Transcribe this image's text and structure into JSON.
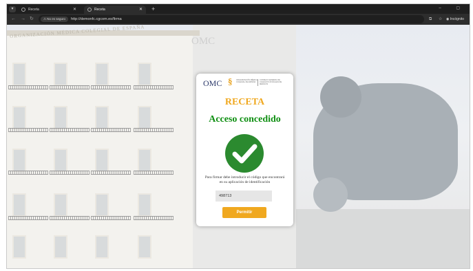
{
  "browser": {
    "tabs": [
      {
        "title": "Receta",
        "active": false
      },
      {
        "title": "Receta",
        "active": true
      }
    ],
    "new_tab": "+",
    "window_controls": "– ▢",
    "security_chip": "No es seguro",
    "url": "http://demonfc.cgcom.es/firma",
    "profile_label": "Incógnito",
    "icons": [
      "menu-icon",
      "back-icon",
      "forward-icon",
      "reload-icon",
      "translate-icon",
      "star-icon",
      "incognito-icon"
    ]
  },
  "background": {
    "building_inscription": "ORGANIZACIÓN MÉDICA COLEGIAL DE ESPAÑA",
    "sign_text": "OMC"
  },
  "card": {
    "logo": {
      "brand": "OMC",
      "mark": "§",
      "left_text": "ORGANIZACIÓN MÉDICA COLEGIAL DE ESPAÑA",
      "right_text": "CONSEJO GENERAL DE COLEGIOS OFICIALES DE MÉDICOS"
    },
    "title": "RECETA",
    "status": "Acceso concedido",
    "instructions": "Para firmar debe introducir el código que encontrará en su aplicación de identificación",
    "code_value": "498713",
    "submit_label": "Permitir",
    "colors": {
      "accent": "#f0a81f",
      "success": "#0f8f12",
      "check_circle": "#2b8a2f"
    }
  }
}
